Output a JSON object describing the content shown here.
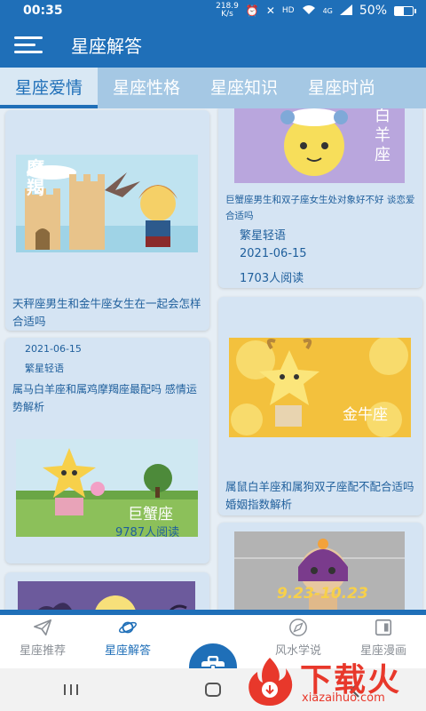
{
  "status_bar": {
    "time": "00:35",
    "net_speed_value": "218.9",
    "net_speed_unit": "K/s",
    "hd": "HD",
    "signal": "4G",
    "battery_percent": "50%",
    "battery_level": 0.5
  },
  "app_bar": {
    "title": "星座解答"
  },
  "tabs": [
    {
      "label": "星座爱情",
      "active": true
    },
    {
      "label": "星座性格",
      "active": false
    },
    {
      "label": "星座知识",
      "active": false
    },
    {
      "label": "星座时尚",
      "active": false
    }
  ],
  "cards": {
    "c1": {
      "art_text": "摩羯",
      "title": "天秤座男生和金牛座女生在一起会怎样 合适吗"
    },
    "c2": {
      "art_text": "白羊座",
      "title": "巨蟹座男生和双子座女生处对象好不好 谈恋爱合适吗",
      "author": "繁星轻语",
      "date": "2021-06-15",
      "reads": "1703人阅读"
    },
    "c3": {
      "date": "2021-06-15",
      "author": "繁星轻语",
      "title": "属马白羊座和属鸡摩羯座最配吗 感情运势解析",
      "art_text": "巨蟹座",
      "reads": "9787人阅读"
    },
    "c4": {
      "art_text": "金牛座",
      "title": "属鼠白羊座和属狗双子座配不配合适吗 婚姻指数解析"
    },
    "c5": {},
    "c6": {
      "art_text": "9.23-10.23"
    }
  },
  "bottom_nav": {
    "items": [
      {
        "label": "星座推荐",
        "icon": "paper-plane-icon",
        "active": false
      },
      {
        "label": "星座解答",
        "icon": "planet-icon",
        "active": true
      },
      {
        "label": "风水学说",
        "icon": "compass-icon",
        "active": false
      },
      {
        "label": "星座漫画",
        "icon": "comic-icon",
        "active": false
      }
    ],
    "center_icon": "briefcase-icon"
  },
  "watermark": {
    "text": "下载火",
    "url": "xiazaihuo.com"
  },
  "colors": {
    "primary": "#1f6fb8",
    "tab_bar": "#a5c8e4",
    "card": "#d5e4f3",
    "watermark": "#e8382b"
  }
}
